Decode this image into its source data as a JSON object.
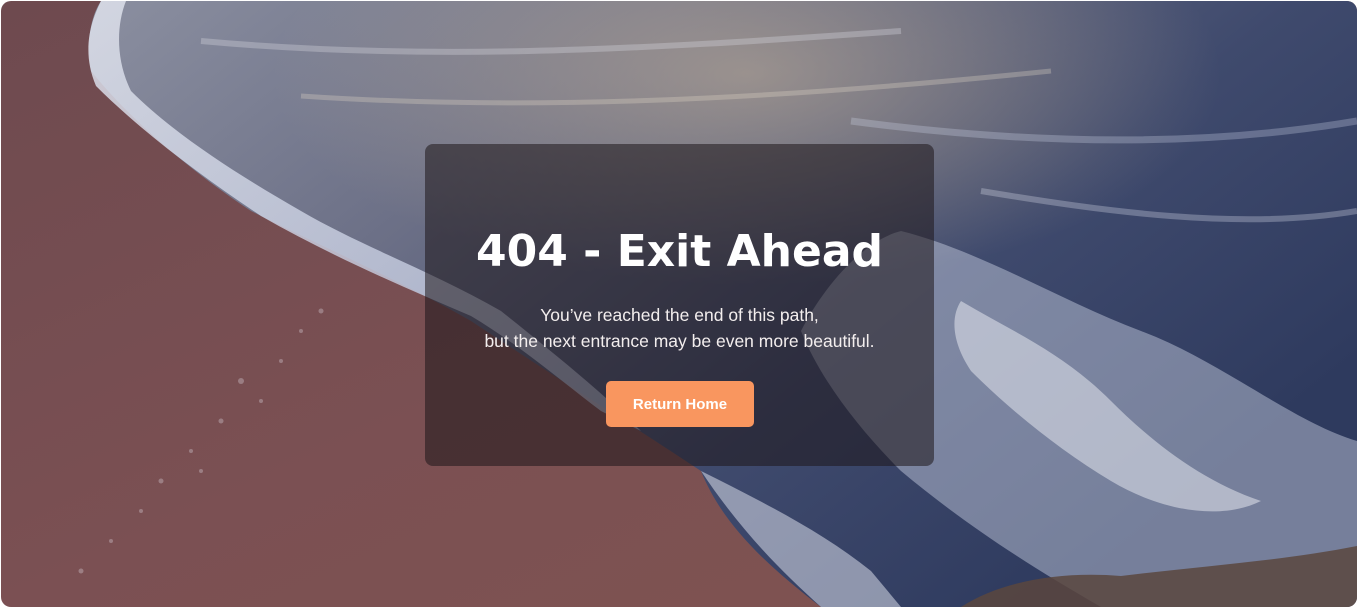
{
  "error_page": {
    "title": "404 - Exit Ahead",
    "message_line_1": "You’ve reached the end of this path,",
    "message_line_2": "but the next entrance may be even more beautiful.",
    "button_label": "Return Home"
  },
  "colors": {
    "button_bg": "#f9965f",
    "card_overlay": "rgba(30,22,26,0.55)",
    "sand": "#7a4f52",
    "water": "#3e4d6d"
  },
  "background": {
    "description_icon": "beach-waves-photo"
  }
}
